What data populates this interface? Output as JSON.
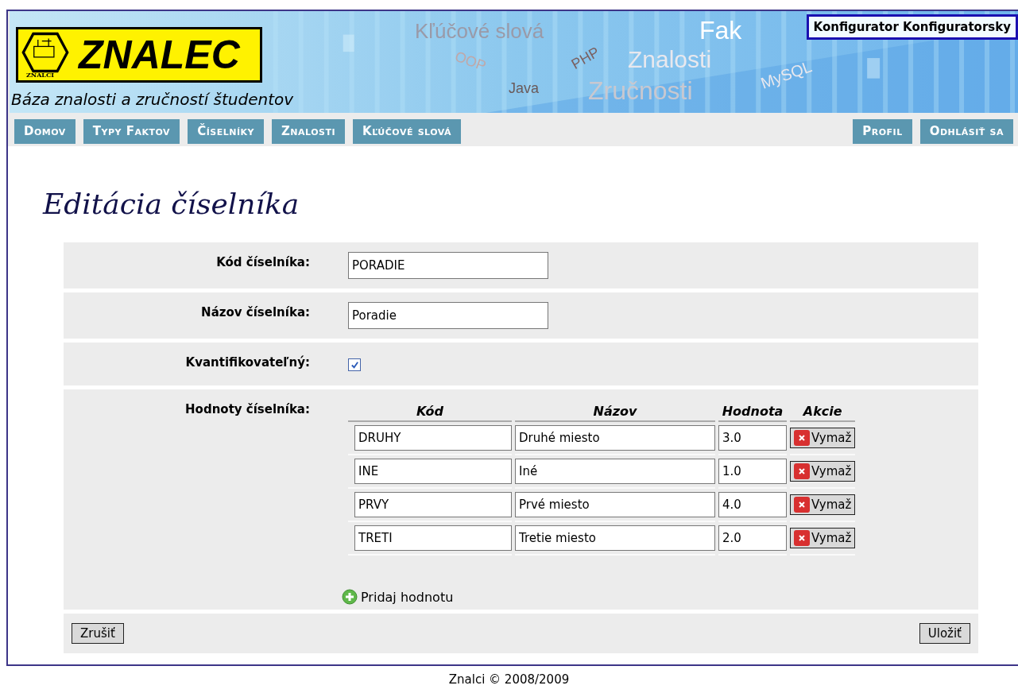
{
  "header": {
    "logo_text": "ZNALEC",
    "logo_badge": "ZNALCI",
    "tagline": "Báza znalosti a zručností študentov",
    "banner_words": [
      "Kľúčové slová",
      "OOP",
      "PHP",
      "Java",
      "Znalosti",
      "Zručnosti",
      "MySQL",
      "Fak"
    ],
    "user": "Konfigurator Konfiguratorsky"
  },
  "nav": {
    "left": [
      "Domov",
      "Typy Faktov",
      "Číselníky",
      "Znalosti",
      "Kľúčové slová"
    ],
    "right": [
      "Profil",
      "Odhlásiť sa"
    ]
  },
  "page_title": "Editácia číselníka",
  "form": {
    "fields": [
      {
        "kind": "text",
        "label": "Kód číselníka:",
        "value": "PORADIE"
      },
      {
        "kind": "text",
        "label": "Názov číselníka:",
        "value": "Poradie"
      },
      {
        "kind": "checkbox",
        "label": "Kvantifikovateľný:",
        "checked": true
      }
    ],
    "values": {
      "label": "Hodnoty číselníka:",
      "columns": [
        "Kód",
        "Názov",
        "Hodnota",
        "Akcie"
      ],
      "rows": [
        {
          "code": "DRUHY",
          "name": "Druhé miesto",
          "value": "3.0",
          "action": "Vymaž"
        },
        {
          "code": "INE",
          "name": "Iné",
          "value": "1.0",
          "action": "Vymaž"
        },
        {
          "code": "PRVY",
          "name": "Prvé miesto",
          "value": "4.0",
          "action": "Vymaž"
        },
        {
          "code": "TRETI",
          "name": "Tretie miesto",
          "value": "2.0",
          "action": "Vymaž"
        }
      ],
      "add": "Pridaj hodnotu"
    },
    "cancel": "Zrušiť",
    "save": "Uložiť"
  },
  "footer": "Znalci © 2008/2009"
}
